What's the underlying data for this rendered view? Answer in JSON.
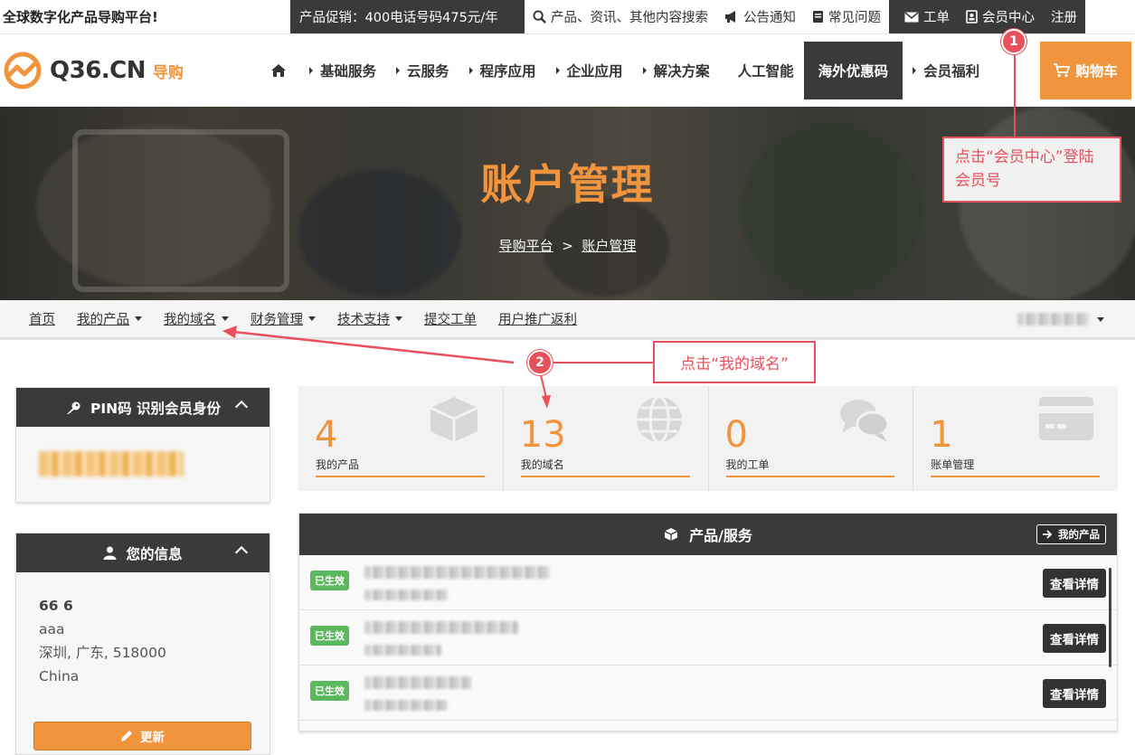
{
  "topbar": {
    "slogan": "全球数字化产品导购平台!",
    "promo": "产品促销：400电话号码475元/年",
    "links": [
      {
        "label": "产品、资讯、其他内容搜索",
        "icon": "search-icon"
      },
      {
        "label": "公告通知",
        "icon": "megaphone-icon"
      },
      {
        "label": "常见问题",
        "icon": "book-icon"
      }
    ],
    "ticket": "工单",
    "member": "会员中心",
    "register": "注册"
  },
  "header": {
    "logo_text": "Q36.CN",
    "logo_sub": "导购",
    "nav": [
      {
        "label": "基础服务",
        "arrow": true
      },
      {
        "label": "云服务",
        "arrow": true
      },
      {
        "label": "程序应用",
        "arrow": true
      },
      {
        "label": "企业应用",
        "arrow": true
      },
      {
        "label": "解决方案",
        "arrow": true
      },
      {
        "label": "人工智能",
        "arrow": false
      },
      {
        "label": "海外优惠码",
        "arrow": false
      },
      {
        "label": "会员福利",
        "arrow": true
      }
    ],
    "cart": "购物车"
  },
  "hero": {
    "title": "账户管理",
    "crumb_home": "导购平台",
    "crumb_sep": ">",
    "crumb_current": "账户管理"
  },
  "subnav": {
    "items": [
      {
        "label": "首页",
        "caret": false
      },
      {
        "label": "我的产品",
        "caret": true
      },
      {
        "label": "我的域名",
        "caret": true
      },
      {
        "label": "财务管理",
        "caret": true
      },
      {
        "label": "技术支持",
        "caret": true
      },
      {
        "label": "提交工单",
        "caret": false
      },
      {
        "label": "用户推广返利",
        "caret": false
      }
    ]
  },
  "pin_panel": {
    "title": "PIN码 识别会员身份"
  },
  "info_panel": {
    "title": "您的信息",
    "name": "66 6",
    "line2": "aaa",
    "line3": "深圳, 广东, 518000",
    "line4": "China",
    "update": "更新"
  },
  "stats": [
    {
      "value": "4",
      "label": "我的产品",
      "icon": "cube-icon"
    },
    {
      "value": "13",
      "label": "我的域名",
      "icon": "globe-icon"
    },
    {
      "value": "0",
      "label": "我的工单",
      "icon": "chat-icon"
    },
    {
      "value": "1",
      "label": "账单管理",
      "icon": "credit-card-icon"
    }
  ],
  "products": {
    "title": "产品/服务",
    "my_products_btn": "我的产品",
    "rows": [
      {
        "status": "已生效",
        "detail": "查看详情"
      },
      {
        "status": "已生效",
        "detail": "查看详情"
      },
      {
        "status": "已生效",
        "detail": "查看详情"
      }
    ]
  },
  "annotations": {
    "step1_num": "1",
    "step1_text": "点击“会员中心”登陆会员号",
    "step2_num": "2",
    "step2_text": "点击“我的域名”"
  },
  "colors": {
    "accent": "#f0943e",
    "dark": "#3a3a3a",
    "annotation": "#e8505b",
    "success": "#5cb85c"
  }
}
